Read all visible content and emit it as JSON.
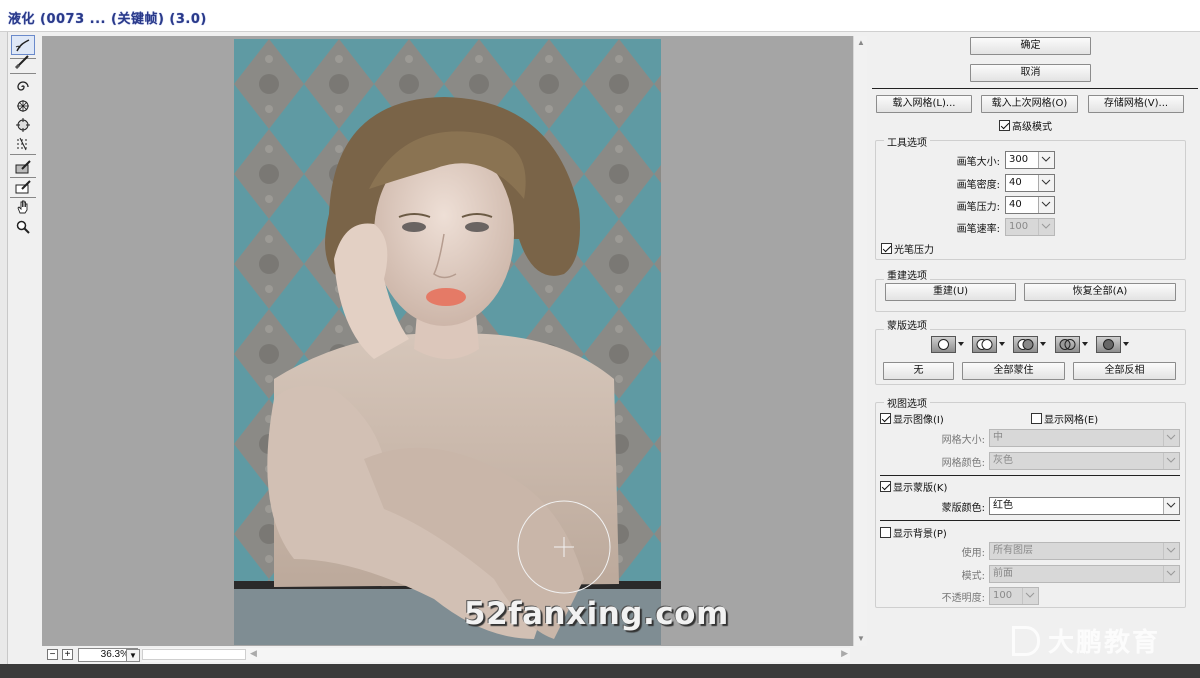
{
  "window": {
    "title": "液化 (0073 ... (关键帧) (3.0)"
  },
  "tools": [
    {
      "name": "forward-warp-tool"
    },
    {
      "name": "reconstruct-tool"
    },
    {
      "name": "twirl-tool"
    },
    {
      "name": "pucker-tool"
    },
    {
      "name": "bloat-tool"
    },
    {
      "name": "push-left-tool"
    },
    {
      "name": "freeze-mask-tool"
    },
    {
      "name": "thaw-mask-tool"
    },
    {
      "name": "hand-tool"
    },
    {
      "name": "zoom-tool"
    }
  ],
  "status": {
    "zoom": "36.3%"
  },
  "panel": {
    "ok_label": "确定",
    "cancel_label": "取消",
    "load_mesh": "载入网格(L)...",
    "load_last_mesh": "载入上次网格(O)",
    "save_mesh": "存储网格(V)...",
    "advanced_mode": {
      "label": "高级模式",
      "checked": true
    },
    "tool_options": {
      "title": "工具选项",
      "brush_size": {
        "label": "画笔大小:",
        "value": "300"
      },
      "brush_density": {
        "label": "画笔密度:",
        "value": "40"
      },
      "brush_pressure": {
        "label": "画笔压力:",
        "value": "40"
      },
      "brush_rate": {
        "label": "画笔速率:",
        "value": "100"
      },
      "stylus_pressure": {
        "label": "光笔压力",
        "checked": true
      }
    },
    "reconstruct_options": {
      "title": "重建选项",
      "reconstruct_label": "重建(U)",
      "restore_all_label": "恢复全部(A)"
    },
    "mask_options": {
      "title": "蒙版选项",
      "none_label": "无",
      "mask_all_label": "全部蒙住",
      "invert_all_label": "全部反相"
    },
    "view_options": {
      "title": "视图选项",
      "show_image": {
        "label": "显示图像(I)",
        "checked": true
      },
      "show_mesh": {
        "label": "显示网格(E)",
        "checked": false
      },
      "mesh_size": {
        "label": "网格大小:",
        "value": "中"
      },
      "mesh_color": {
        "label": "网格颜色:",
        "value": "灰色"
      },
      "show_mask": {
        "label": "显示蒙版(K)",
        "checked": true
      },
      "mask_color": {
        "label": "蒙版颜色:",
        "value": "红色"
      },
      "show_backdrop": {
        "label": "显示背景(P)",
        "checked": false
      },
      "use": {
        "label": "使用:",
        "value": "所有图层"
      },
      "mode": {
        "label": "模式:",
        "value": "前面"
      },
      "opacity": {
        "label": "不透明度:",
        "value": "100"
      }
    }
  },
  "overlays": {
    "watermark": "52fanxing.com",
    "logo": "大鹏教育"
  }
}
